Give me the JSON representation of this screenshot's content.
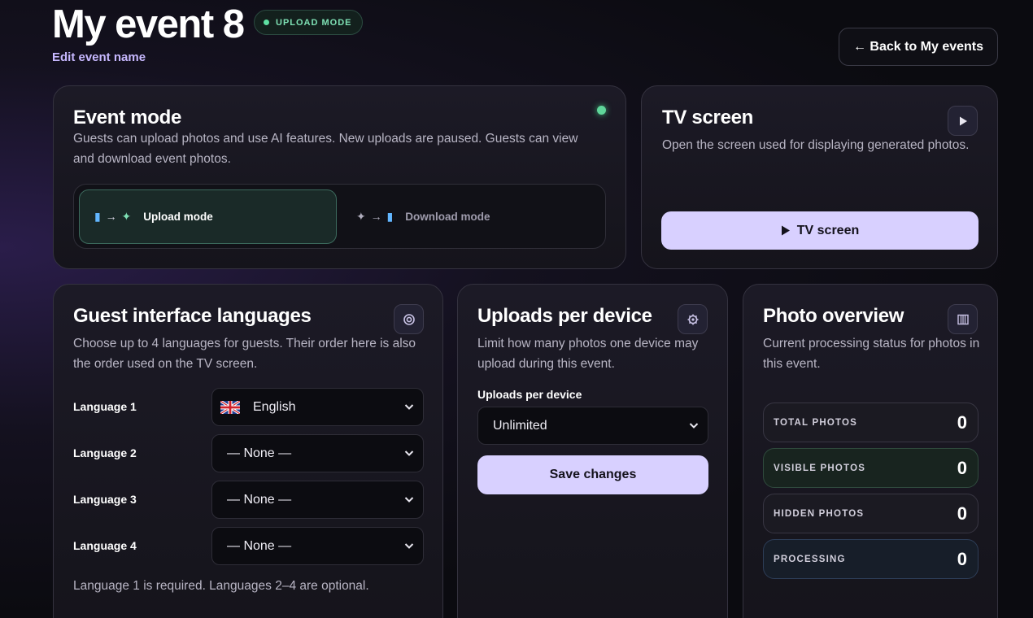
{
  "header": {
    "title": "My event 8",
    "mode_badge": "UPLOAD MODE",
    "edit_link": "Edit event name",
    "back_button": "← Back to My events"
  },
  "event_mode": {
    "title": "Event mode",
    "description": "Guests can upload photos and use AI features. New uploads are paused. Guests can view and download event photos.",
    "options": [
      {
        "label": "Upload mode",
        "selected": true
      },
      {
        "label": "Download mode",
        "selected": false
      }
    ],
    "status_color": "#5fd69a"
  },
  "tv_screen": {
    "title": "TV screen",
    "description": "Open the screen used for displaying generated photos.",
    "button_label": "TV screen",
    "icon": "play-icon"
  },
  "languages": {
    "title": "Guest interface languages",
    "description": "Choose up to 4 languages for guests. Their order here is also the order used on the TV screen.",
    "rows": [
      {
        "label": "Language 1",
        "value": "English",
        "flag": "uk-flag-icon"
      },
      {
        "label": "Language 2",
        "value": "— None —"
      },
      {
        "label": "Language 3",
        "value": "— None —"
      },
      {
        "label": "Language 4",
        "value": "— None —"
      }
    ],
    "note": "Language 1 is required. Languages 2–4 are optional.",
    "icon": "globe-icon"
  },
  "uploads": {
    "title": "Uploads per device",
    "description": "Limit how many photos one device may upload during this event.",
    "field_label": "Uploads per device",
    "value": "Unlimited",
    "save_label": "Save changes",
    "icon": "gear-icon"
  },
  "photo_overview": {
    "title": "Photo overview",
    "description": "Current processing status for photos in this event.",
    "stats": [
      {
        "label": "TOTAL PHOTOS",
        "value": "0"
      },
      {
        "label": "VISIBLE PHOTOS",
        "value": "0"
      },
      {
        "label": "HIDDEN PHOTOS",
        "value": "0"
      },
      {
        "label": "PROCESSING",
        "value": "0"
      }
    ],
    "icon": "grid-icon"
  },
  "colors": {
    "accent": "#d8d0ff",
    "success": "#5fe0a3",
    "link": "#c7b8ff"
  }
}
